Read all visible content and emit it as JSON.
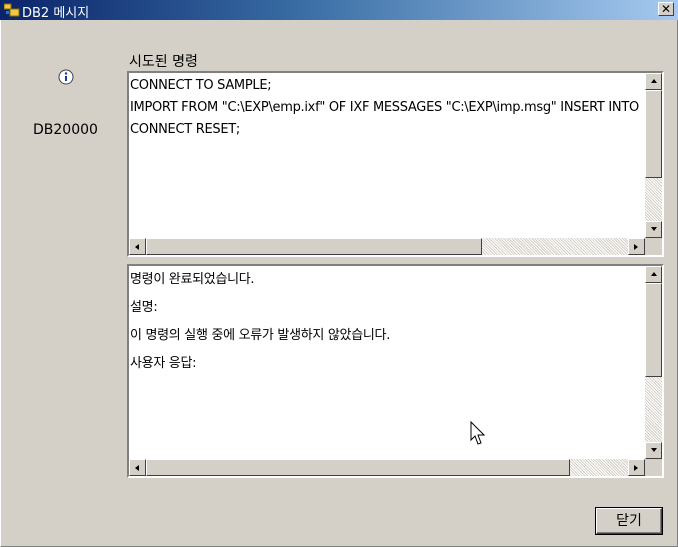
{
  "window": {
    "title": "DB2 메시지",
    "close_glyph": "✕"
  },
  "message": {
    "code": "DB20000",
    "icon": "info-icon"
  },
  "command_section": {
    "label": "시도된 명령",
    "lines": [
      "CONNECT TO SAMPLE;",
      "IMPORT FROM \"C:\\EXP\\emp.ixf\" OF IXF MESSAGES \"C:\\EXP\\imp.msg\" INSERT INTO",
      "CONNECT RESET;"
    ]
  },
  "result_section": {
    "lines": [
      "명령이 완료되었습니다.",
      "설명:",
      " 이 명령의 실행 중에 오류가 발생하지 않았습니다.",
      "사용자   응답:"
    ]
  },
  "buttons": {
    "close_label": "닫기"
  },
  "colors": {
    "title_gradient_start": "#0a246a",
    "title_gradient_end": "#a6caf0",
    "dialog_bg": "#d4d0c8"
  }
}
